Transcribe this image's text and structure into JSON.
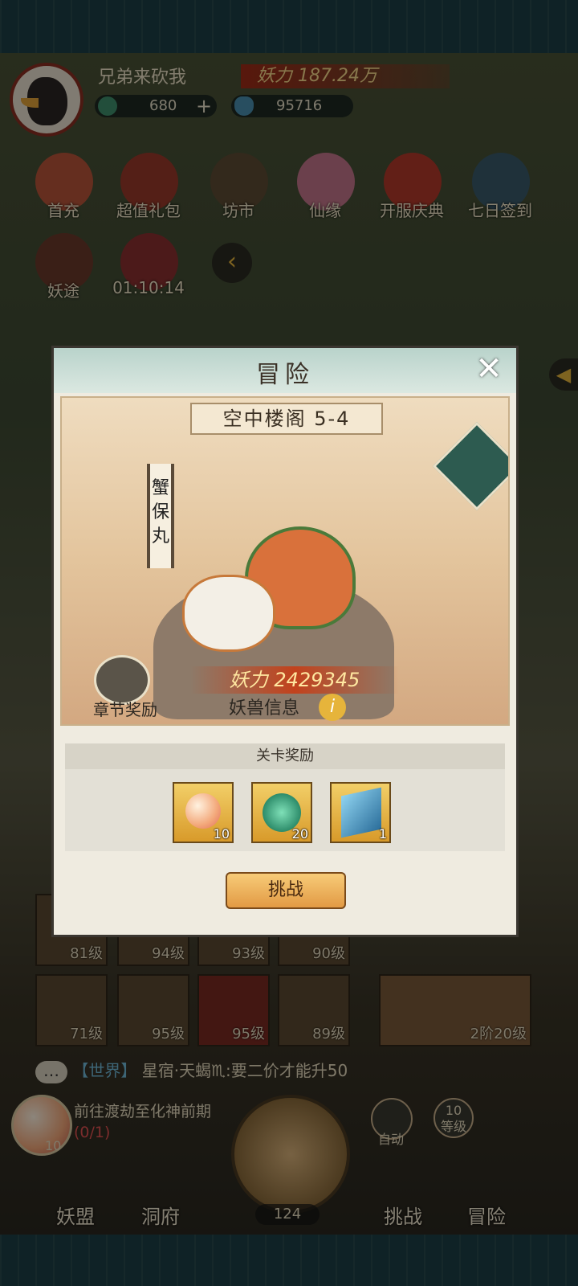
{
  "player": {
    "name": "兄弟来砍我",
    "power_label": "妖力 187.24万",
    "currency1": "680",
    "currency1_add": "+",
    "currency2": "95716"
  },
  "top_icons": [
    {
      "label": "首充",
      "icon": "gift-dragon-icon"
    },
    {
      "label": "超值礼包",
      "icon": "treasure-bag-icon"
    },
    {
      "label": "坊市",
      "icon": "market-coin-icon"
    },
    {
      "label": "仙缘",
      "icon": "lotus-icon"
    },
    {
      "label": "开服庆典",
      "icon": "present-box-icon"
    },
    {
      "label": "七日签到",
      "icon": "calendar-orb-icon"
    }
  ],
  "second_icons": [
    {
      "label": "妖途",
      "icon": "book-icon"
    },
    {
      "label": "01:10:14",
      "icon": "timed-gift-icon"
    }
  ],
  "modal": {
    "title": "冒险",
    "close": "✕",
    "stage_name": "空中楼阁 5-4",
    "boss_name": "蟹保丸",
    "stage_power": "妖力 2429345",
    "chapter_reward": "章节奖励",
    "beast_info": "妖兽信息",
    "info_icon": "i",
    "reward_header": "关卡奖励",
    "rewards": [
      {
        "icon": "peach-icon",
        "count": "10"
      },
      {
        "icon": "jade-dragon-icon",
        "count": "20"
      },
      {
        "icon": "talisman-scroll-icon",
        "count": "1"
      }
    ],
    "challenge_button": "挑战"
  },
  "slots_row1": [
    "81级",
    "94级",
    "93级",
    "90级"
  ],
  "slots_row2": [
    "71级",
    "95级",
    "95级",
    "89级"
  ],
  "slot_side": "2阶20级",
  "chat": {
    "channel": "【世界】",
    "message": "星宿·天蝎♏:要二价才能升50"
  },
  "quest": {
    "text": "前往渡劫至化神前期",
    "progress": "(0/1)",
    "count": "10"
  },
  "right_buttons": [
    {
      "label": "自动"
    },
    {
      "label": "10\n等级"
    }
  ],
  "bottom_tabs": [
    "妖盟",
    "洞府",
    "挑战",
    "冒险"
  ],
  "axe_count": "124",
  "colors": {
    "modal_bg": "#efebe0",
    "header_teal": "#b9d3cb",
    "power_red": "#c83c14",
    "button_orange": "#e29a44"
  }
}
